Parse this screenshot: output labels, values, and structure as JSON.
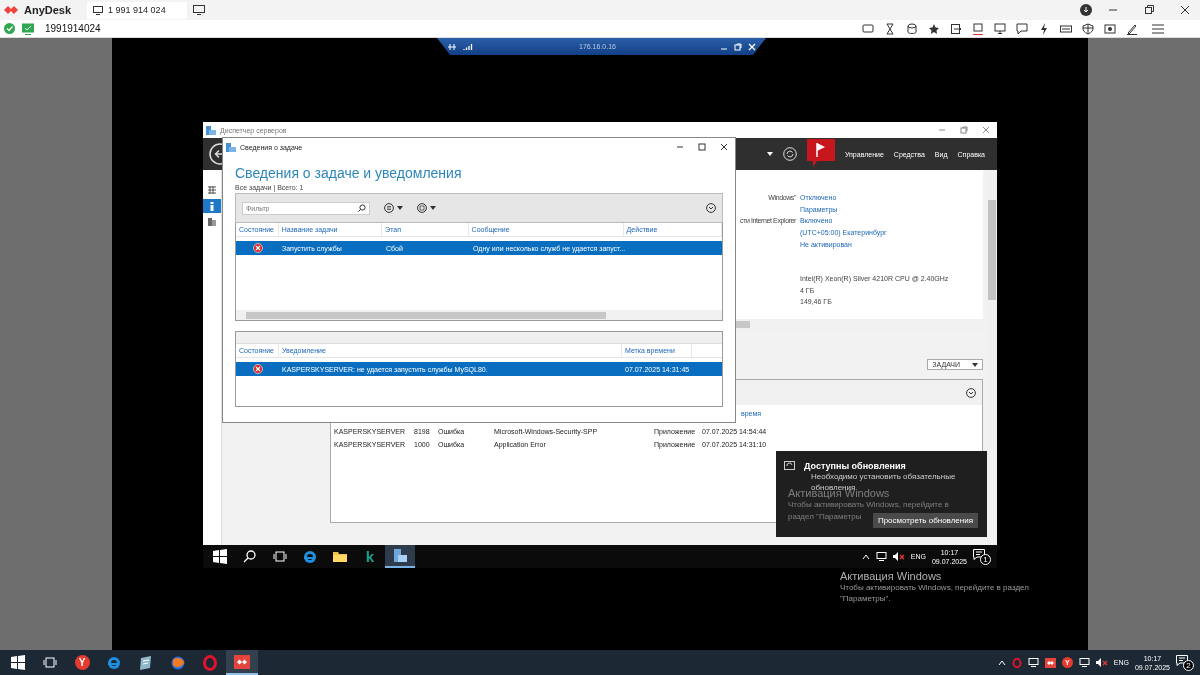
{
  "anydesk": {
    "app_name": "AnyDesk",
    "tab_label": "1 991 914 024",
    "address": "1991914024"
  },
  "remote_toolbar": {
    "address": "176.16.0.16"
  },
  "server_manager": {
    "title": "Диспетчер серверов",
    "menu": [
      "Управление",
      "Средства",
      "Вид",
      "Справка"
    ],
    "sidebar": [
      {
        "selected": false
      },
      {
        "selected": true
      },
      {
        "selected": false
      }
    ],
    "properties": [
      {
        "label": "Windows\"",
        "value": "Отключено"
      },
      {
        "value": "Параметры"
      },
      {
        "label": "сти Internet Explorer",
        "value": "Включено"
      },
      {
        "value": "(UTC+05:00) Екатеринбург"
      },
      {
        "value": "Не активирован"
      }
    ],
    "hardware": [
      {
        "value": "Intel(R) Xeon(R) Silver 4210R CPU @ 2.40GHz"
      },
      {
        "value": "4 ГБ"
      },
      {
        "value": "149,46 ГБ"
      }
    ],
    "tasks_button": "ЗАДАЧИ",
    "events": {
      "column_partial": "время",
      "rows": [
        {
          "server": "KASPERSKYSERVER",
          "id": "8198",
          "severity": "Ошибка",
          "source": "Microsoft-Windows-Security-SPP",
          "log": "Приложение",
          "date": "07.07.2025 14:54:44"
        },
        {
          "server": "KASPERSKYSERVER",
          "id": "1000",
          "severity": "Ошибка",
          "source": "Application Error",
          "log": "Приложение",
          "date": "07.07.2025 14:31:10"
        }
      ]
    }
  },
  "dialog": {
    "title": "Сведения о задаче",
    "heading": "Сведения о задаче и уведомления",
    "summary": "Все задачи | Всего: 1",
    "filter": {
      "placeholder": "Фильтр"
    },
    "tasks": {
      "columns": [
        "Состояние",
        "Название задачи",
        "Этап",
        "Сообщение",
        "Действие"
      ],
      "rows": [
        {
          "selected": true,
          "kind": "error",
          "name": "Запустить службы",
          "stage": "Сбой",
          "message": "Одну или несколько служб не удается запуст..."
        }
      ]
    },
    "notifications": {
      "columns": [
        "Состояние",
        "Уведомление",
        "Метка времени"
      ],
      "rows": [
        {
          "selected": true,
          "kind": "error",
          "text": "KASPERSKYSERVER: не удается запустить службы MySQL80.",
          "time": "07.07.2025 14:31:45"
        }
      ]
    }
  },
  "toast": {
    "title": "Доступны обновления",
    "body": "Необходимо установить обязательные обновления",
    "button": "Просмотреть обновления"
  },
  "remote_watermark": {
    "title": "Активация Windows",
    "lines": [
      "Чтобы активировать Windows, перейдите в",
      "раздел \"Параметры"
    ]
  },
  "remote_taskbar": {
    "apps": [
      {
        "kind": "start",
        "selected": false
      },
      {
        "kind": "search",
        "selected": false
      },
      {
        "kind": "taskview",
        "selected": false
      },
      {
        "kind": "browser",
        "selected": false
      },
      {
        "kind": "folder",
        "selected": false
      },
      {
        "kind": "letter",
        "label": "k",
        "selected": false
      },
      {
        "kind": "server",
        "selected": true
      }
    ],
    "tray": {
      "language": "ENG",
      "time": "10:17",
      "date": "09.07.2025",
      "notifications": "1"
    }
  },
  "local_watermark": {
    "title": "Активация Windows",
    "text": "Чтобы активировать Windows, перейдите в раздел \"Параметры\"."
  },
  "local_taskbar": {
    "apps": [
      {
        "kind": "start",
        "selected": false
      },
      {
        "kind": "taskview",
        "selected": false
      },
      {
        "kind": "letter",
        "label": "Y",
        "selected": false
      },
      {
        "kind": "browser",
        "selected": false
      },
      {
        "kind": "app",
        "selected": false
      },
      {
        "kind": "browser2",
        "selected": false
      },
      {
        "kind": "ring",
        "selected": false
      },
      {
        "kind": "diamond",
        "selected": true
      }
    ],
    "tray": {
      "badge_label": "Y",
      "language": "ENG",
      "time": "10:17",
      "date": "09.07.2025",
      "notifications": "2"
    }
  }
}
